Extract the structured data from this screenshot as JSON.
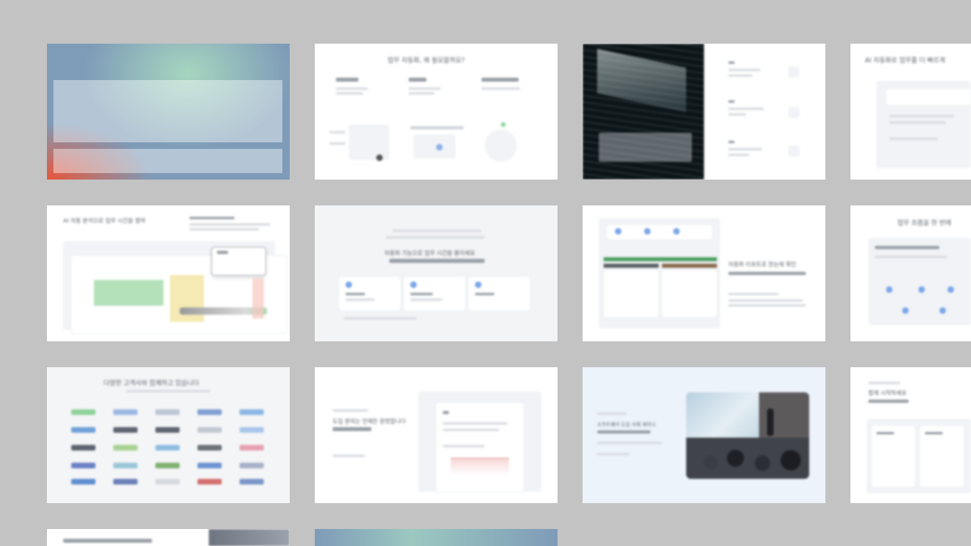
{
  "grid": {
    "rows": [
      [
        {
          "name": "slide-cover-gradient"
        },
        {
          "name": "slide-three-columns",
          "heading": "업무 자동화, 왜 필요할까요?"
        },
        {
          "name": "slide-data-visual"
        },
        {
          "name": "slide-edge-top-right",
          "heading": "AI 자동화로 업무를 더 빠르게"
        }
      ],
      [
        {
          "name": "slide-spreadsheet",
          "heading": "AI 자동 분석으로 업무 시간을 절약"
        },
        {
          "name": "slide-three-cards",
          "heading": "자동화 기능으로 업무 시간을 줄이세요"
        },
        {
          "name": "slide-report-table",
          "heading": "자동화 리포트로 한눈에 확인"
        },
        {
          "name": "slide-edge-middle-right",
          "heading": "업무 흐름을 한 번에"
        }
      ],
      [
        {
          "name": "slide-logo-wall",
          "heading": "다양한 고객사와 함께하고 있습니다"
        },
        {
          "name": "slide-text-document",
          "heading": "도입 문의는 언제든 환영합니다"
        },
        {
          "name": "slide-event-photo",
          "heading": "소프트웨어 도입 사례 세미나"
        },
        {
          "name": "slide-edge-bottom-right",
          "heading": "함께 시작하세요"
        }
      ],
      [
        {
          "name": "slide-partial-white"
        },
        {
          "name": "slide-partial-gradient"
        }
      ]
    ]
  },
  "colors": {
    "background": "#c3c3c3",
    "slide": "#ffffff",
    "gradient_blue": "#7e9bb8",
    "gradient_green": "#a6d6bf",
    "gradient_orange": "#e7563a",
    "dark_panel": "#0c1518",
    "photo_dark": "#2b2e34",
    "sheet_green": "#9bd7a2",
    "sheet_yellow": "#f3e6a6",
    "accent_blue": "#7aa6e8"
  }
}
